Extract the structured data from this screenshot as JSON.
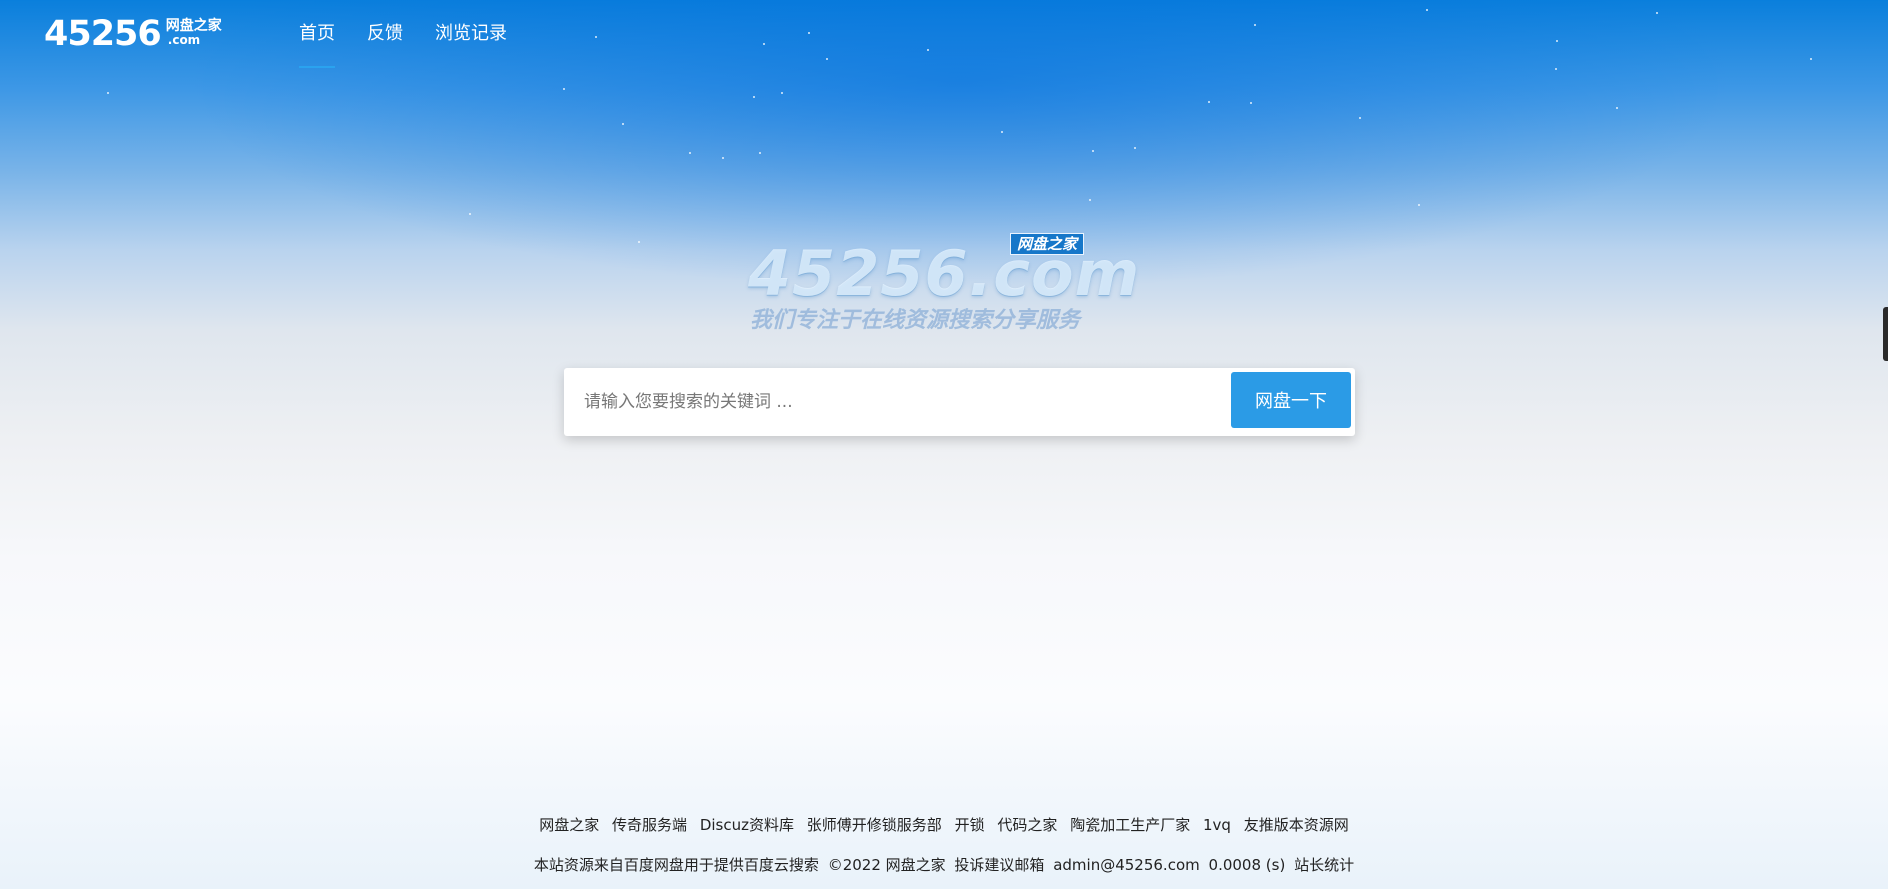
{
  "header": {
    "logo": {
      "number": "45256",
      "name": "网盘之家",
      "domain": ".com"
    },
    "nav": [
      {
        "label": "首页",
        "active": true
      },
      {
        "label": "反馈",
        "active": false
      },
      {
        "label": "浏览记录",
        "active": false
      }
    ]
  },
  "brand": {
    "badge": "网盘之家",
    "main": "45256.com",
    "slogan": "我们专注于在线资源搜索分享服务"
  },
  "search": {
    "placeholder": "请输入您要搜索的关键词 ...",
    "value": "",
    "button_label": "网盘一下"
  },
  "footer": {
    "links": [
      "网盘之家",
      "传奇服务端",
      "Discuz资料库",
      "张师傅开修锁服务部",
      "开锁",
      "代码之家",
      "陶瓷加工生产厂家",
      "1vq",
      "友推版本资源网"
    ],
    "source_text": "本站资源来自百度网盘用于提供百度云搜索",
    "copyright": "©2022 网盘之家",
    "contact_label": "投诉建议邮箱",
    "email": "admin@45256.com",
    "timing": "0.0008 (s)",
    "stats_label": "站长统计"
  },
  "colors": {
    "accent": "#2b9be6",
    "sky": "#0a7fdc"
  }
}
